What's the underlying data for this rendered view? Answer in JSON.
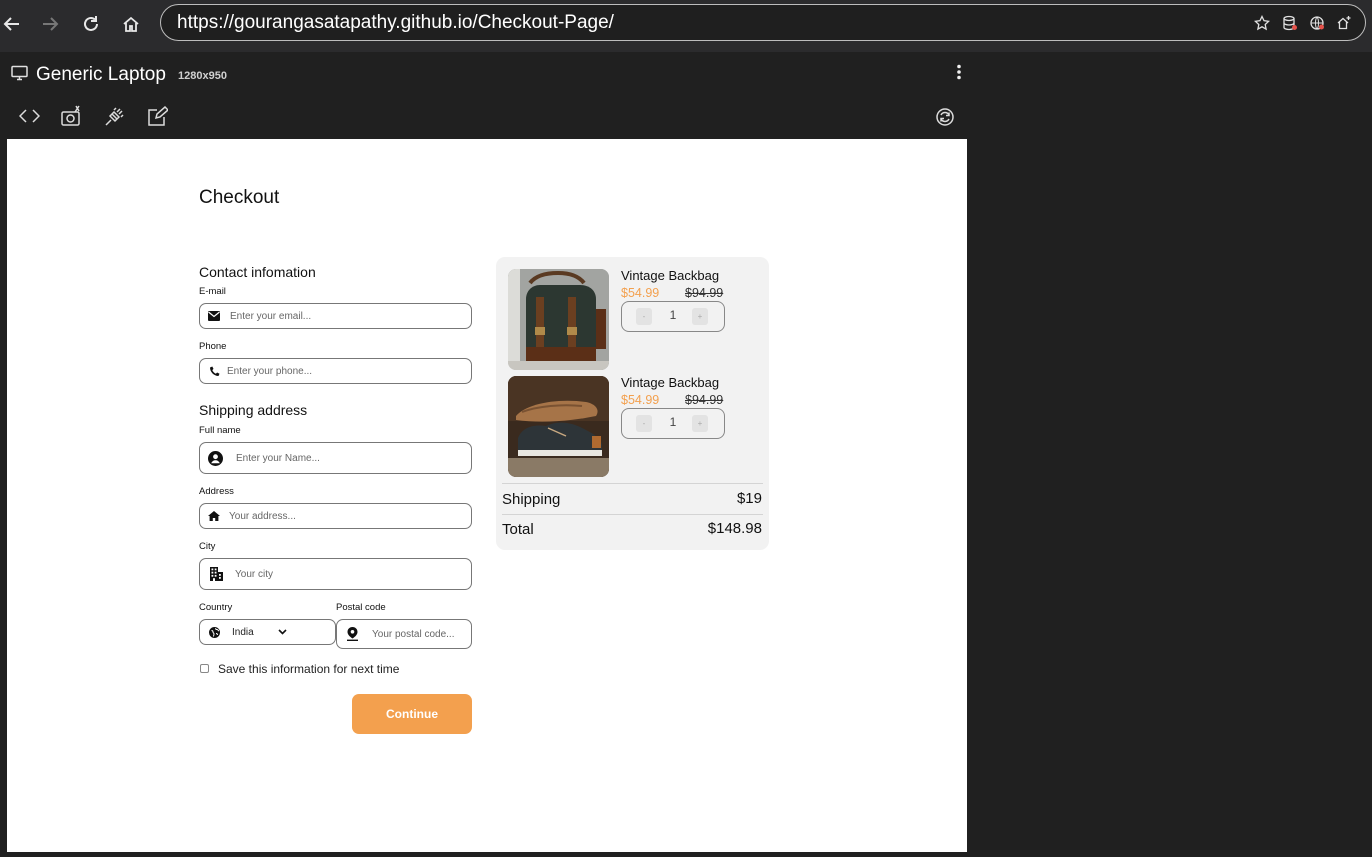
{
  "browser": {
    "url": "https://gourangasatapathy.github.io/Checkout-Page/"
  },
  "devtools": {
    "device_name": "Generic Laptop",
    "device_size": "1280x950"
  },
  "page": {
    "title": "Checkout",
    "contact": {
      "title": "Contact infomation",
      "email_label": "E-mail",
      "email_placeholder": "Enter your email...",
      "phone_label": "Phone",
      "phone_placeholder": "Enter your phone..."
    },
    "shipping": {
      "title": "Shipping address",
      "fullname_label": "Full name",
      "fullname_placeholder": "Enter your Name...",
      "address_label": "Address",
      "address_placeholder": "Your address...",
      "city_label": "City",
      "city_placeholder": "Your city",
      "country_label": "Country",
      "country_value": "India",
      "postal_label": "Postal code",
      "postal_placeholder": "Your postal code..."
    },
    "save_label": "Save this information for next time",
    "continue_label": "Continue",
    "accent_color": "#f3a04e"
  },
  "cart": {
    "items": [
      {
        "name": "Vintage Backbag",
        "price": "$54.99",
        "old_price": "$94.99",
        "qty": "1",
        "minus": "-",
        "plus": "+"
      },
      {
        "name": "Vintage Backbag",
        "price": "$54.99",
        "old_price": "$94.99",
        "qty": "1",
        "minus": "-",
        "plus": "+"
      }
    ],
    "shipping_label": "Shipping",
    "shipping_value": "$19",
    "total_label": "Total",
    "total_value": "$148.98"
  }
}
